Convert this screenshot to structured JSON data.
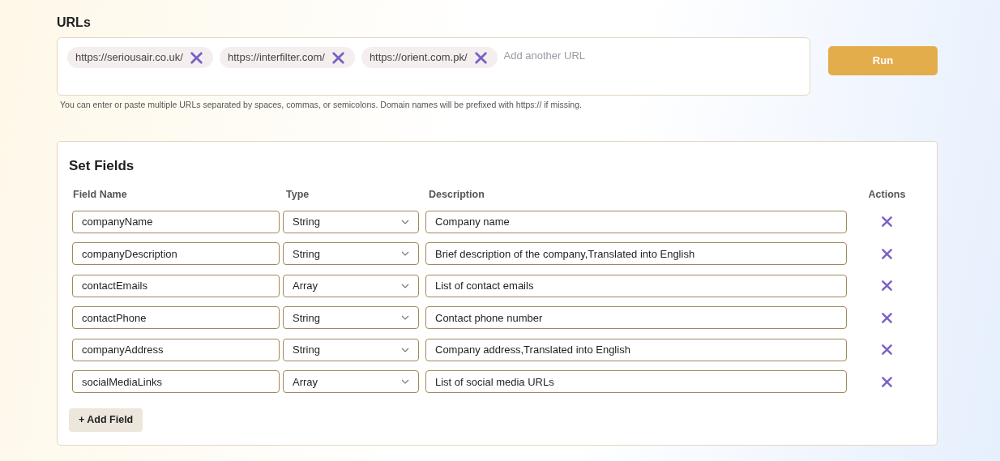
{
  "urls": {
    "title": "URLs",
    "tags": [
      "https://seriousair.co.uk/",
      "https://interfilter.com/",
      "https://orient.com.pk/"
    ],
    "placeholder": "Add another URL",
    "hint": "You can enter or paste multiple URLs separated by spaces, commas, or semicolons. Domain names will be prefixed with https:// if missing.",
    "run_button": "Run"
  },
  "fields": {
    "title": "Set Fields",
    "columns": [
      "Field Name",
      "Type",
      "Description",
      "Actions"
    ],
    "rows": [
      {
        "name": "companyName",
        "type": "String",
        "description": "Company name"
      },
      {
        "name": "companyDescription",
        "type": "String",
        "description": "Brief description of the company,Translated into English"
      },
      {
        "name": "contactEmails",
        "type": "Array",
        "description": "List of contact emails"
      },
      {
        "name": "contactPhone",
        "type": "String",
        "description": "Contact phone number"
      },
      {
        "name": "companyAddress",
        "type": "String",
        "description": "Company address,Translated into English"
      },
      {
        "name": "socialMediaLinks",
        "type": "Array",
        "description": "List of social media URLs"
      }
    ],
    "add_button": "+ Add Field"
  }
}
